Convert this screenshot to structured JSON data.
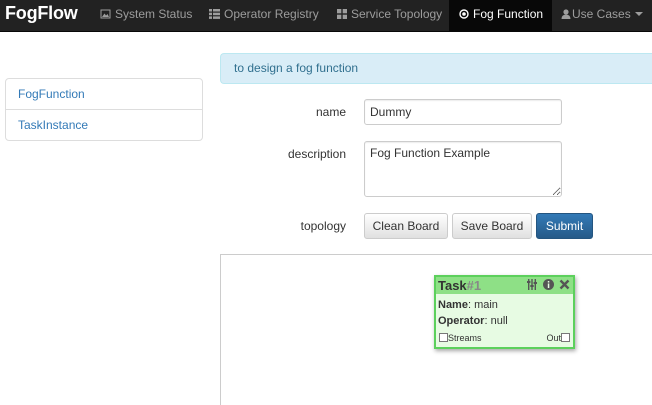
{
  "navbar": {
    "brand": "FogFlow",
    "items": [
      {
        "label": "System Status",
        "icon": "picture-icon"
      },
      {
        "label": "Operator Registry",
        "icon": "list-icon"
      },
      {
        "label": "Service Topology",
        "icon": "grid-icon"
      },
      {
        "label": "Fog Function",
        "icon": "record-icon",
        "active": true
      },
      {
        "label": "Use Cases",
        "icon": "user-icon",
        "dropdown": true
      }
    ]
  },
  "sidebar": {
    "items": [
      {
        "label": "FogFunction"
      },
      {
        "label": "TaskInstance"
      }
    ]
  },
  "alert": {
    "text": "to design a fog function"
  },
  "form": {
    "name_label": "name",
    "name_value": "Dummy",
    "description_label": "description",
    "description_value": "Fog Function Example",
    "topology_label": "topology",
    "clean_label": "Clean Board",
    "save_label": "Save Board",
    "submit_label": "Submit"
  },
  "task_node": {
    "title": "Task",
    "number": "#1",
    "name_key": "Name",
    "name_value": ": main",
    "operator_key": "Operator",
    "operator_value": ": null",
    "in_port": "Streams",
    "out_port": "Out"
  },
  "colors": {
    "navbar": "#222222",
    "link": "#337ab7",
    "alert_bg": "#d9edf7",
    "alert_text": "#31708f",
    "primary": "#337ab7",
    "task_border": "#5cd05c",
    "task_bg": "#e7fbe3"
  }
}
